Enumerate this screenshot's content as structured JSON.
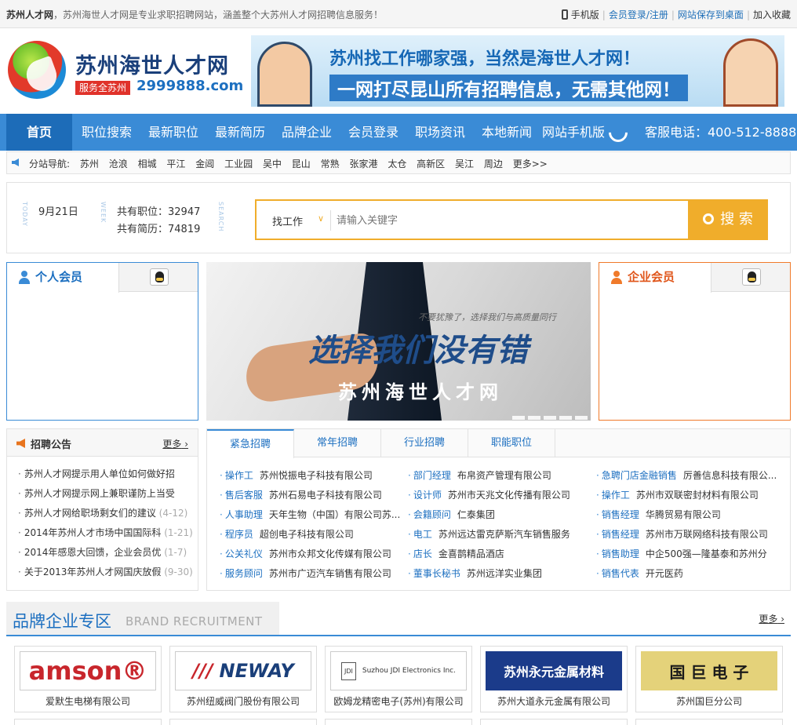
{
  "topbar": {
    "site_name": "苏州人才网",
    "intro": "，苏州海世人才网是专业求职招聘网站，涵盖整个大苏州人才网招聘信息服务！",
    "mobile": "手机版",
    "login": "会员登录/注册",
    "save_desktop": "网站保存到桌面",
    "favorite": "加入收藏"
  },
  "header": {
    "brand": "苏州海世人才网",
    "badge": "服务全苏州",
    "domain": "2999888.com",
    "banner_line1": "苏州找工作哪家强，当然是海世人才网！",
    "banner_line2": "一网打尽昆山所有招聘信息，无需其他网！"
  },
  "nav": {
    "home": "首页",
    "items": [
      "职位搜索",
      "最新职位",
      "最新简历",
      "品牌企业",
      "会员登录",
      "职场资讯",
      "本地新闻",
      "网站手机版"
    ],
    "hotline": "客服电话：400-512-8888"
  },
  "subnav": {
    "label": "分站导航:",
    "items": [
      "苏州",
      "沧浪",
      "相城",
      "平江",
      "金阊",
      "工业园",
      "吴中",
      "昆山",
      "常熟",
      "张家港",
      "太仓",
      "高新区",
      "吴江",
      "周边",
      "更多>>"
    ]
  },
  "search": {
    "today_label": "TODAY",
    "week_label": "WEEK",
    "search_label": "SEARCH",
    "date": "9月21日",
    "jobs": "共有职位：32947",
    "resumes": "共有简历：74819",
    "category": "找工作",
    "placeholder": "请输入关键字",
    "button": "搜 索"
  },
  "members": {
    "personal": "个人会员",
    "company": "企业会员"
  },
  "slide": {
    "tagline": "不要犹豫了，选择我们与高质量同行",
    "headline": "选择我们没有错",
    "name": "苏州海世人才网"
  },
  "notice": {
    "title": "招聘公告",
    "more": "更多",
    "items": [
      {
        "text": "苏州人才网提示用人单位如何做好招",
        "date": ""
      },
      {
        "text": "苏州人才网提示网上兼职谨防上当受",
        "date": ""
      },
      {
        "text": "苏州人才网给职场剩女们的建议",
        "date": "(4-12)"
      },
      {
        "text": "2014年苏州人才市场中国国际科",
        "date": "(1-21)"
      },
      {
        "text": "2014年感恩大回馈，企业会员优",
        "date": "(1-7)"
      },
      {
        "text": "关于2013年苏州人才网国庆放假",
        "date": "(9-30)"
      }
    ]
  },
  "jobs": {
    "tabs": [
      "紧急招聘",
      "常年招聘",
      "行业招聘",
      "职能职位"
    ],
    "col1": [
      {
        "t": "操作工",
        "c": "苏州悦振电子科技有限公司"
      },
      {
        "t": "售后客服",
        "c": "苏州石易电子科技有限公司"
      },
      {
        "t": "人事助理",
        "c": "天年生物（中国）有限公司苏..."
      },
      {
        "t": "程序员",
        "c": "超创电子科技有限公司"
      },
      {
        "t": "公关礼仪",
        "c": "苏州市众邦文化传媒有限公司"
      },
      {
        "t": "服务顾问",
        "c": "苏州市广迈汽车销售有限公司"
      }
    ],
    "col2": [
      {
        "t": "部门经理",
        "c": "布帛资产管理有限公司"
      },
      {
        "t": "设计师",
        "c": "苏州市天兆文化传播有限公司"
      },
      {
        "t": "会籍顾问",
        "c": "仁泰集团"
      },
      {
        "t": "电工",
        "c": "苏州远达雷克萨斯汽车销售服务"
      },
      {
        "t": "店长",
        "c": "金喜鹊精品酒店"
      },
      {
        "t": "董事长秘书",
        "c": "苏州远洋实业集团"
      }
    ],
    "col3": [
      {
        "t": "急聘门店金融销售",
        "c": "厉善信息科技有限公..."
      },
      {
        "t": "操作工",
        "c": "苏州市双联密封材料有限公司"
      },
      {
        "t": "销售经理",
        "c": "华腾贸易有限公司"
      },
      {
        "t": "销售经理",
        "c": "苏州市万联网络科技有限公司"
      },
      {
        "t": "销售助理",
        "c": "中企500强—隆基泰和苏州分"
      },
      {
        "t": "销售代表",
        "c": "开元医药"
      }
    ]
  },
  "brandzone": {
    "title": "品牌企业专区",
    "en": "BRAND RECRUITMENT",
    "more": "更多",
    "companies": [
      {
        "logo": "amson®",
        "name": "爱默生电梯有限公司",
        "color": "#c8262c"
      },
      {
        "logo": "NEWAY",
        "name": "苏州纽威阀门股份有限公司",
        "color": "#1a3f7a"
      },
      {
        "logo": "Suzhou JDI Electronics Inc.",
        "name": "欧姆龙精密电子(苏州)有限公司",
        "color": "#333333"
      },
      {
        "logo": "苏州永元金属材料",
        "name": "苏州大道永元金属有限公司",
        "color": "#ffffff"
      },
      {
        "logo": "国 巨 电 子",
        "name": "苏州国巨分公司",
        "color": "#1a1a1a"
      }
    ]
  }
}
